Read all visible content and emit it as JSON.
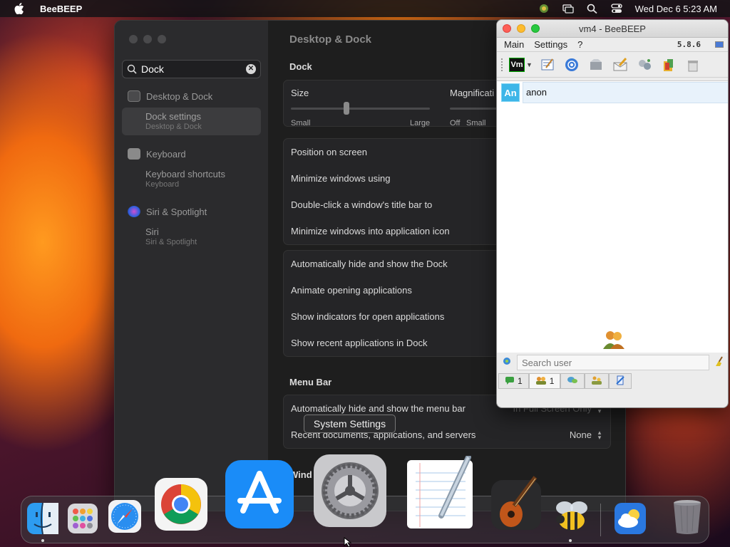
{
  "menubar": {
    "app_name": "BeeBEEP",
    "clock": "Wed Dec 6  5:23 AM"
  },
  "settings": {
    "search_value": "Dock",
    "sidebar": [
      {
        "section": "Desktop & Dock",
        "item": "Dock settings",
        "sub": "Desktop & Dock",
        "selected": true
      },
      {
        "section": "Keyboard",
        "item": "Keyboard shortcuts",
        "sub": "Keyboard",
        "selected": false
      },
      {
        "section": "Siri & Spotlight",
        "item": "Siri",
        "sub": "Siri & Spotlight",
        "selected": false
      }
    ],
    "page_title": "Desktop & Dock",
    "dock_header": "Dock",
    "size_label": "Size",
    "size_small": "Small",
    "size_large": "Large",
    "size_value": 0.4,
    "magnification_label": "Magnificati",
    "mag_off": "Off",
    "mag_small": "Small",
    "rows_group1": [
      "Position on screen",
      "Minimize windows using",
      "Double-click a window's title bar to",
      "Minimize windows into application icon"
    ],
    "rows_group2": [
      "Automatically hide and show the Dock",
      "Animate opening applications",
      "Show indicators for open applications",
      "Show recent applications in Dock"
    ],
    "menubar_header": "Menu Bar",
    "menubar_row1": "Automatically hide and show the menu bar",
    "menubar_row1_value": "In Full Screen Only",
    "menubar_row2": "Recent documents, applications, and servers",
    "menubar_row2_value": "None",
    "windows_header": "Wind"
  },
  "beebeep": {
    "title": "vm4 - BeeBEEP",
    "menu": [
      "Main",
      "Settings",
      "?"
    ],
    "version": "5.8.6",
    "status_badge": "Vm",
    "users": [
      {
        "initials": "An",
        "name": "anon"
      }
    ],
    "search_placeholder": "Search user",
    "tabs": [
      {
        "label": "1",
        "icon": "chat-icon"
      },
      {
        "label": "1",
        "icon": "users-icon"
      },
      {
        "label": "",
        "icon": "groups-chat-icon"
      },
      {
        "label": "",
        "icon": "groups-icon"
      },
      {
        "label": "",
        "icon": "files-icon"
      }
    ]
  },
  "tooltip": "System Settings",
  "dock": {
    "apps": [
      "Finder",
      "Launchpad",
      "Safari",
      "Google Chrome",
      "App Store",
      "System Settings",
      "TextEdit",
      "GarageBand",
      "BeeBEEP",
      "Weather",
      "Trash"
    ]
  }
}
